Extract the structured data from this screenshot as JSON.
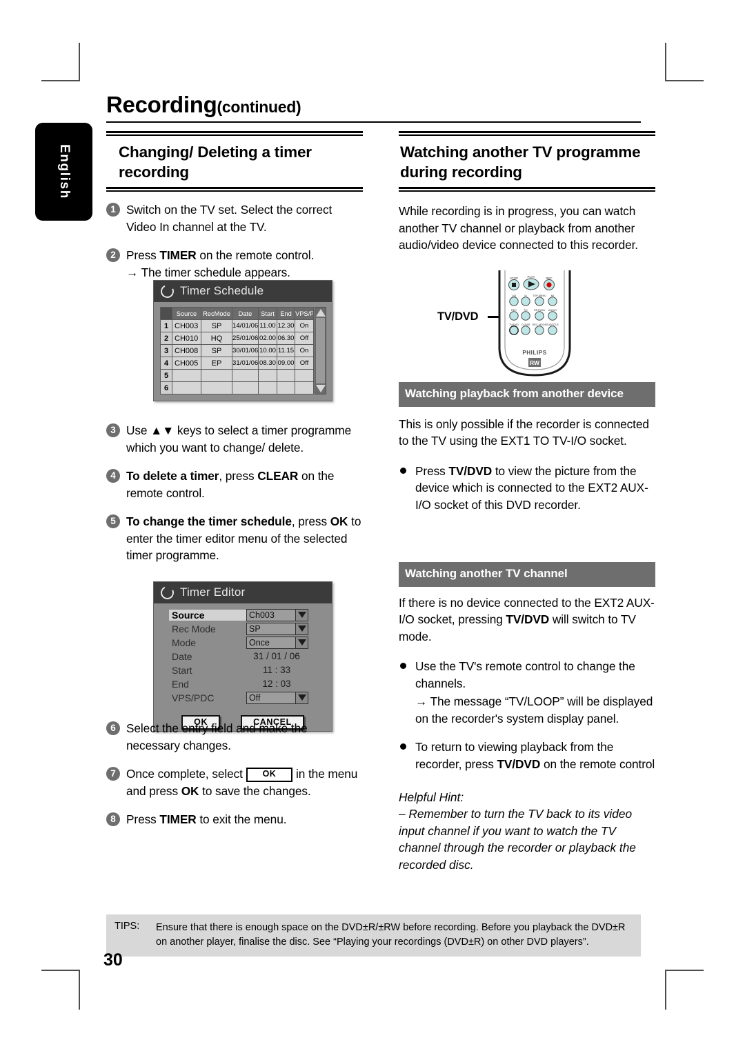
{
  "page": {
    "title_main": "Recording",
    "title_cont": "(continued)",
    "language_tab": "English",
    "page_number": "30"
  },
  "left_column": {
    "heading": "Changing/ Deleting a timer recording",
    "steps": [
      {
        "num": "1",
        "html": "Switch on the TV set. Select the correct Video In channel at the TV."
      },
      {
        "num": "2",
        "html": "Press <b>TIMER</b> on the remote control."
      },
      {
        "num": "3",
        "html": "Use ▲▼ keys to select a timer programme which you want to change/ delete."
      },
      {
        "num": "4",
        "html": "<b>To delete a timer</b>, press <b>CLEAR</b> on the remote control."
      },
      {
        "num": "5",
        "html": "<b>To change the timer schedule</b>, press <b>OK</b> to enter the timer editor menu of the selected timer programme."
      },
      {
        "num": "6",
        "html": "Select the entry field and make the necessary changes."
      },
      {
        "num": "7",
        "html": "Once complete, select <span class=\"okbox\">OK</span> in the menu and press <b>OK</b> to save the changes."
      },
      {
        "num": "8",
        "html": "Press <b>TIMER</b> to exit the menu."
      }
    ],
    "step2_sub": "→ The timer schedule appears.",
    "step7_ok_label": "OK"
  },
  "timer_schedule": {
    "title": "Timer Schedule",
    "columns": [
      "",
      "Source",
      "RecMode",
      "Date",
      "Start",
      "End",
      "VPS/PDC"
    ],
    "rows": [
      {
        "idx": "1",
        "source": "CH003",
        "recmode": "SP",
        "date": "14/01/06",
        "start": "11.00",
        "end": "12.30",
        "vps": "On"
      },
      {
        "idx": "2",
        "source": "CH010",
        "recmode": "HQ",
        "date": "25/01/06",
        "start": "02.00",
        "end": "06.30",
        "vps": "Off"
      },
      {
        "idx": "3",
        "source": "CH008",
        "recmode": "SP",
        "date": "30/01/06",
        "start": "10.00",
        "end": "11.15",
        "vps": "On"
      },
      {
        "idx": "4",
        "source": "CH005",
        "recmode": "EP",
        "date": "31/01/06",
        "start": "08.30",
        "end": "09.00",
        "vps": "Off"
      },
      {
        "idx": "5",
        "source": "",
        "recmode": "",
        "date": "",
        "start": "",
        "end": "",
        "vps": ""
      },
      {
        "idx": "6",
        "source": "",
        "recmode": "",
        "date": "",
        "start": "",
        "end": "",
        "vps": ""
      }
    ]
  },
  "timer_editor": {
    "title": "Timer Editor",
    "fields": [
      {
        "label": "Source",
        "value": "Ch003",
        "type": "dropdown",
        "selected": true
      },
      {
        "label": "Rec Mode",
        "value": "SP",
        "type": "dropdown",
        "selected": false
      },
      {
        "label": "Mode",
        "value": "Once",
        "type": "dropdown",
        "selected": false
      },
      {
        "label": "Date",
        "value": "31 / 01 / 06",
        "type": "plain",
        "selected": false
      },
      {
        "label": "Start",
        "value": "11 : 33",
        "type": "plain",
        "selected": false
      },
      {
        "label": "End",
        "value": "12 : 03",
        "type": "plain",
        "selected": false
      },
      {
        "label": "VPS/PDC",
        "value": "Off",
        "type": "dropdown",
        "selected": false
      }
    ],
    "ok_label": "OK",
    "cancel_label": "CANCEL"
  },
  "right_column": {
    "heading": "Watching another TV programme during recording",
    "intro": "While recording is in progress, you can watch another TV channel or playback from another audio/video device connected to this recorder.",
    "remote_callout": "TV/DVD",
    "remote_brand": "PHILIPS",
    "remote_badge": "RW",
    "section1": {
      "heading": "Watching playback from another device",
      "paragraph": "This is only possible if the recorder is connected to the TV using the EXT1 TO TV-I/O socket.",
      "bullet": "Press <b>TV/DVD</b> to view the picture from the device which is connected to the EXT2 AUX-I/O socket of this DVD recorder."
    },
    "section2": {
      "heading": "Watching another TV channel",
      "paragraph": "If there is no device connected to the EXT2 AUX-I/O socket, pressing <b>TV/DVD</b> will switch to TV mode.",
      "bullet1": "Use the TV's remote control to change the channels.",
      "bullet1_sub": "→ The message “TV/LOOP” will be displayed on the recorder's system display panel.",
      "bullet2": "To return to viewing playback from the recorder, press <b>TV/DVD</b> on the remote control"
    },
    "hint_title": "Helpful Hint:",
    "hint_body": "– Remember to turn the TV back to its video input channel if you want to watch the TV channel through the recorder or playback the recorded disc."
  },
  "tips": {
    "label": "TIPS:",
    "text": "Ensure that there is enough space on the DVD±R/±RW before recording. Before you playback the DVD±R on another player, finalise the disc. See “Playing your recordings (DVD±R) on other DVD players”."
  }
}
